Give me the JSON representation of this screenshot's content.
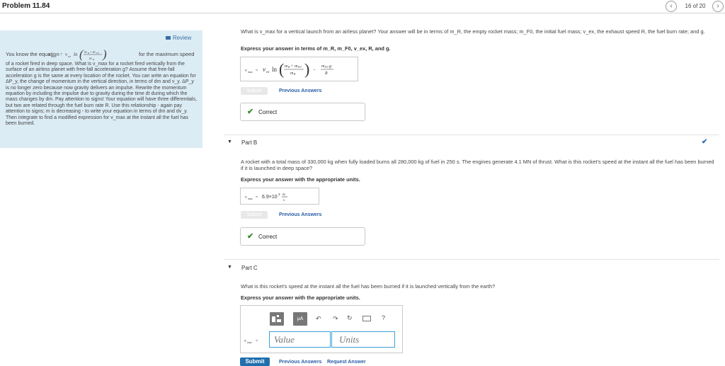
{
  "header": {
    "title": "Problem 11.84",
    "pager": "16 of 20",
    "prev_icon": "‹",
    "next_icon": "›"
  },
  "hint": {
    "review": "Review",
    "line1_pre": "You know the equation ",
    "formula": "v_max = v_ex ln((m_R + m_F0)/m_R)",
    "line1_post": " for the maximum speed",
    "body": "of a rocket fired in deep space. What is v_max for a rocket fired vertically from the surface of an airless planet with free-fall acceleration g? Assume that free-fall acceleration g is the same at every location of the rocket. You can write an equation for ΔP_y, the change of momentum in the vertical direction, in terms of dm and v_y. ΔP_y is no longer zero because now gravity delivers an impulse. Rewrite the momentum equation by including the impulse due to gravity during the time dt during which the mass changes by dm. Pay attention to signs! Your equation will have three differentials, but two are related through the fuel burn rate R. Use this relationship - again pay attention to signs; m is decreasing - to write your equation in terms of dm and dv_y. Then integrate to find a modified expression for v_max at the instant all the fuel has been burned."
  },
  "part_a": {
    "question": "What is v_max for a vertical launch from an airless planet? Your answer will be in terms of m_R, the empty rocket mass; m_F0, the initial fuel mass; v_ex, the exhaust speed R, the fuel burn rate; and g.",
    "instruction": "Express your answer in terms of m_R, m_F0, v_ex, R, and g.",
    "answer_label": "v_max =",
    "answer_expr": "v_ex ln((m_R + m_F0)/m_R) − m_F0 g / R",
    "submit": "Submit",
    "previous_answers": "Previous Answers",
    "status": "Correct"
  },
  "part_b": {
    "toggle": "▼",
    "title": "Part B",
    "question": "A rocket with a total mass of 330,000 kg when fully loaded burns all 280,000 kg of fuel in 250 s. The engines generate 4.1 MN of thrust. What is this rocket's speed at the instant all the fuel has been burned if it is launched in deep space?",
    "instruction": "Express your answer with the appropriate units.",
    "answer_label": "v_max =",
    "answer_value": "6.9×10³ m/s",
    "submit": "Submit",
    "previous_answers": "Previous Answers",
    "status": "Correct"
  },
  "part_c": {
    "toggle": "▼",
    "title": "Part C",
    "question": "What is this rocket's speed at the instant all the fuel has been burned if it is launched vertically from the earth?",
    "instruction": "Express your answer with the appropriate units.",
    "answer_label": "v_max =",
    "value_placeholder": "Value",
    "units_placeholder": "Units",
    "toolbar": {
      "units_label": "μA",
      "undo_icon": "↶",
      "redo_icon": "↷",
      "reset_icon": "↻",
      "help_label": "?"
    },
    "submit": "Submit",
    "previous_answers": "Previous Answers",
    "request_answer": "Request Answer"
  },
  "colors": {
    "hint_bg": "#dcecf5",
    "link": "#2a5ea8",
    "correct": "#3a8a2e",
    "submit_active": "#1f6fae",
    "input_border": "#3aa0d6"
  }
}
